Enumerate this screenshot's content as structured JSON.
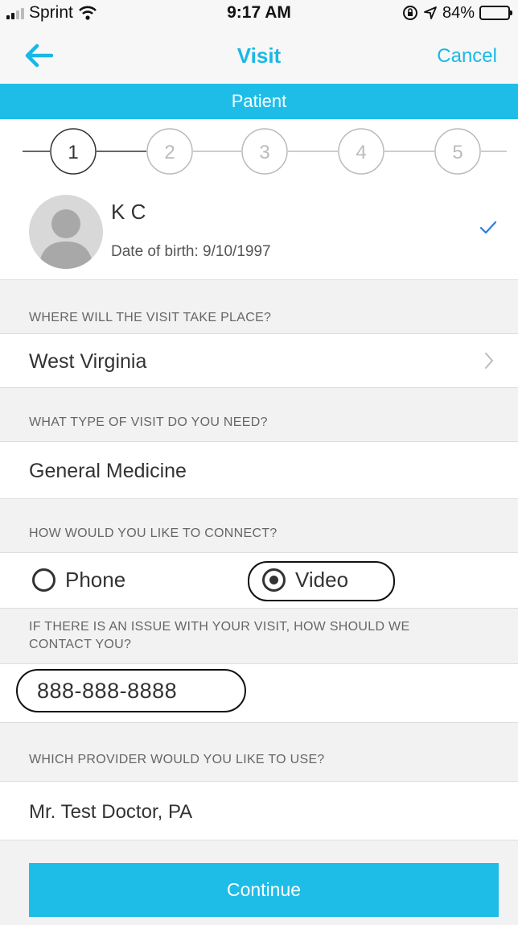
{
  "status_bar": {
    "carrier": "Sprint",
    "time": "9:17 AM",
    "battery": "84%",
    "battery_level": 0.84,
    "icons": [
      "signal-icon",
      "wifi-icon",
      "orientation-lock-icon",
      "location-icon",
      "battery-icon"
    ]
  },
  "nav": {
    "title": "Visit",
    "cancel_label": "Cancel",
    "back_icon": "back-arrow-icon"
  },
  "banner": {
    "title": "Patient"
  },
  "stepper": {
    "steps": [
      "1",
      "2",
      "3",
      "4",
      "5"
    ],
    "current": 1
  },
  "patient": {
    "name": "K C",
    "dob": "Date of birth: 9/10/1997",
    "selected": true
  },
  "location": {
    "header": "WHERE WILL THE VISIT TAKE PLACE?",
    "value": "West Virginia"
  },
  "visit_type": {
    "header": "WHAT TYPE OF VISIT DO YOU NEED?",
    "value": "General Medicine"
  },
  "connect": {
    "header": "HOW WOULD YOU LIKE TO CONNECT?",
    "options": [
      "Phone",
      "Video"
    ],
    "selected": "Video"
  },
  "contact": {
    "header_line1": "IF THERE IS AN ISSUE WITH YOUR VISIT, HOW SHOULD WE",
    "header_line2": "CONTACT YOU?",
    "value": "888-888-8888"
  },
  "provider": {
    "header": "WHICH PROVIDER WOULD YOU LIKE TO USE?",
    "value": "Mr. Test Doctor, PA"
  },
  "actions": {
    "continue_label": "Continue"
  },
  "colors": {
    "accent": "#1ebde8",
    "text": "#333333",
    "background": "#f2f2f2"
  }
}
